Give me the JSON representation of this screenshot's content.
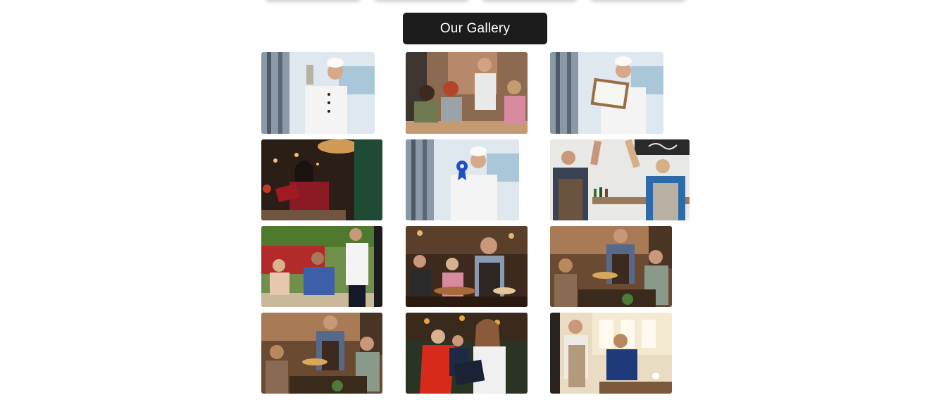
{
  "gallery": {
    "title": "Our Gallery"
  },
  "photos": [
    {
      "id": "chef-trophy"
    },
    {
      "id": "waiter-serving-friends"
    },
    {
      "id": "chef-holding-board"
    },
    {
      "id": "woman-reading-menu"
    },
    {
      "id": "chef-with-ribbon"
    },
    {
      "id": "staff-high-five"
    },
    {
      "id": "waiter-card-payment"
    },
    {
      "id": "waiter-serving-food-1"
    },
    {
      "id": "waiter-serving-group-1"
    },
    {
      "id": "waiter-serving-group-2"
    },
    {
      "id": "hostess-with-menus"
    },
    {
      "id": "waitress-taking-order"
    }
  ]
}
